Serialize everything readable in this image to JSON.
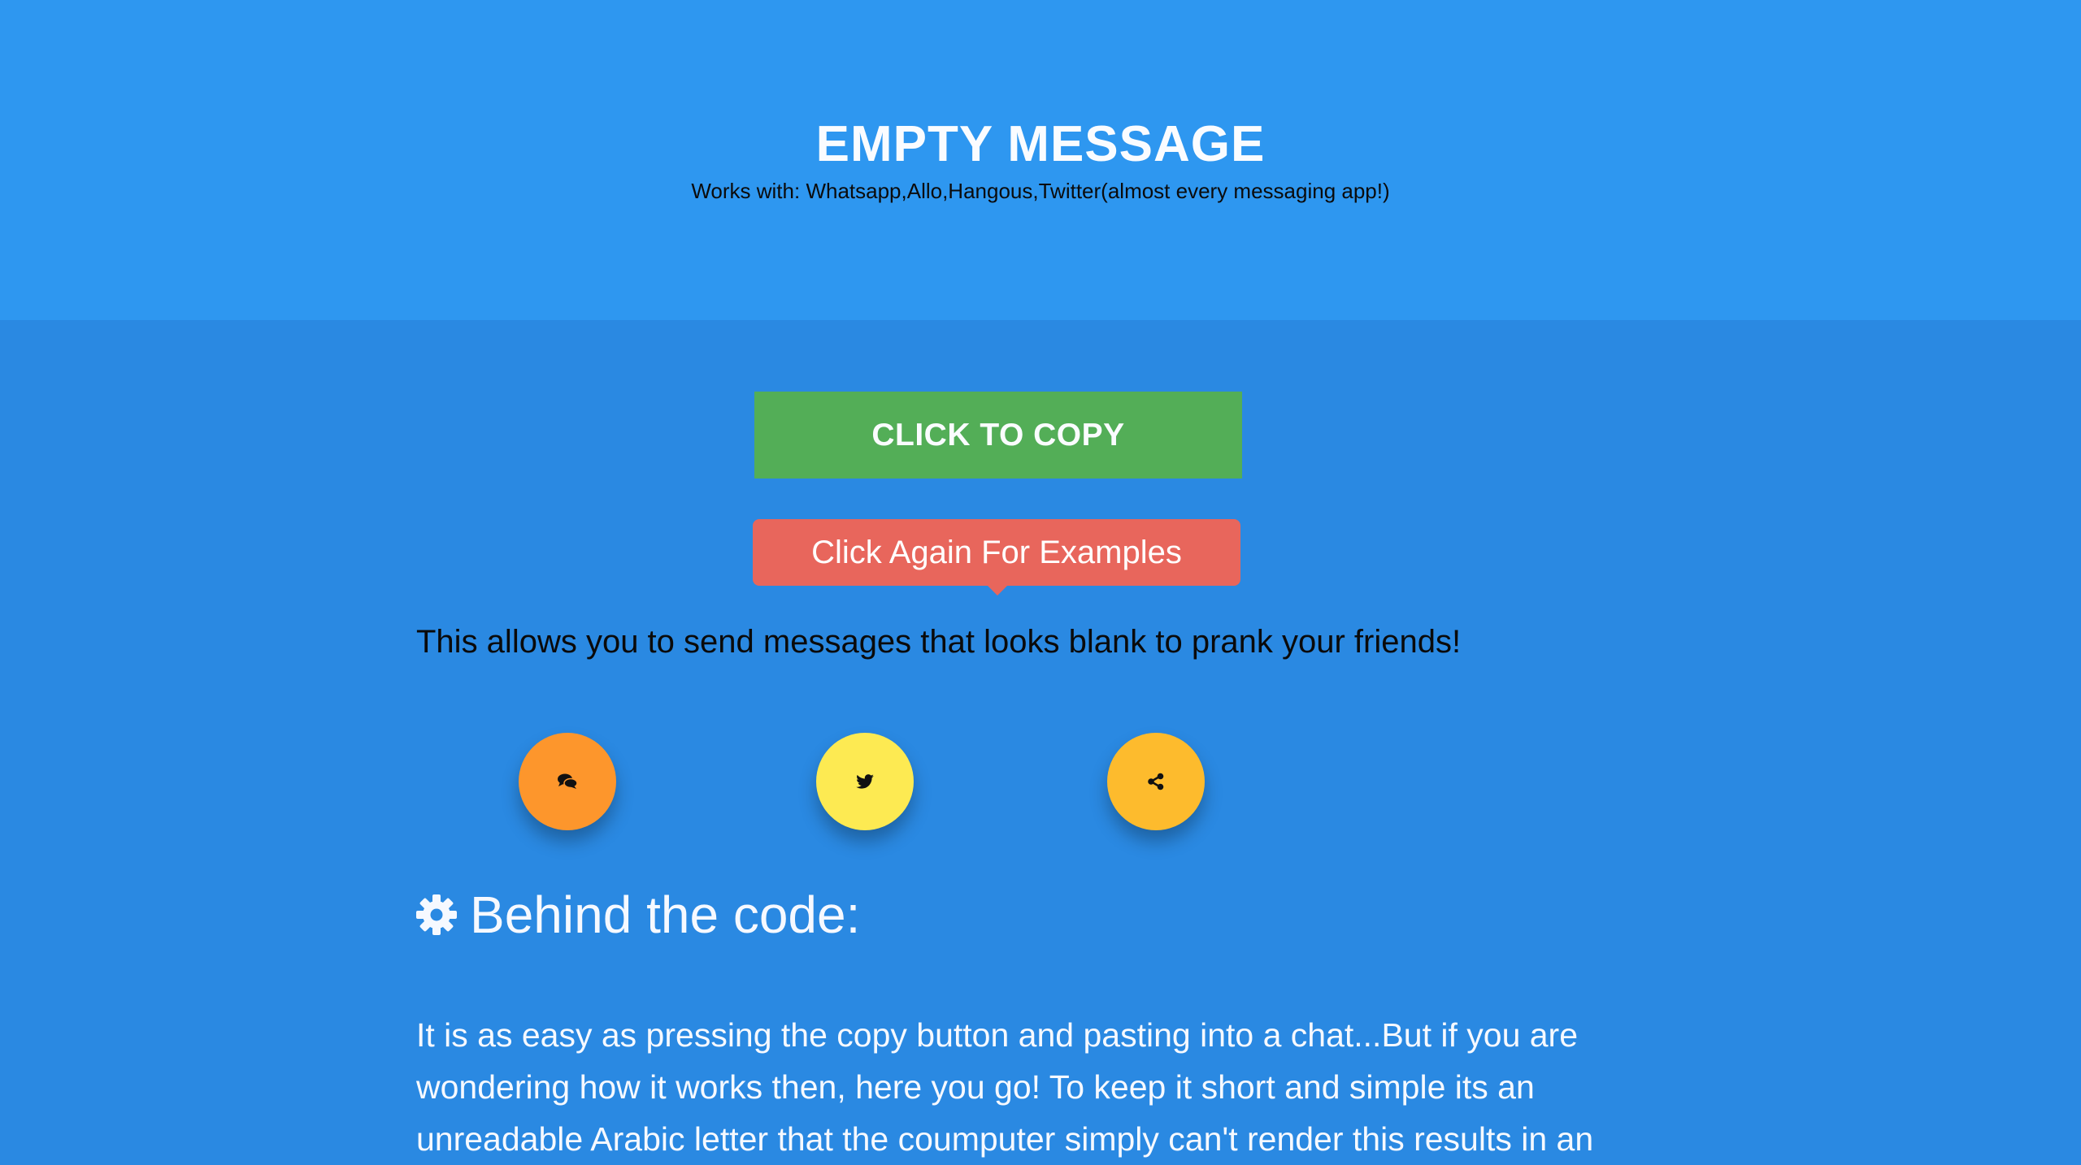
{
  "header": {
    "title": "EMPTY MESSAGE",
    "subtitle": "Works with: Whatsapp,Allo,Hangous,Twitter(almost every messaging app!)"
  },
  "main": {
    "copy_button_label": "CLICK TO COPY",
    "tooltip_text": "Click Again For Examples",
    "description": "This allows you to send messages that looks blank to prank your friends!",
    "share_buttons": [
      {
        "icon": "chat-icon",
        "color": "#fd962c"
      },
      {
        "icon": "twitter-icon",
        "color": "#fdea52"
      },
      {
        "icon": "share-icon",
        "color": "#fdbb2d"
      }
    ],
    "section_title": "Behind the code:",
    "section_icon": "gear-icon",
    "body_text": "It is as easy as pressing the copy button and pasting into a chat...But if you are wondering how it works then, here you go! To keep it short and simple its an unreadable Arabic letter that the coumputer simply can't render this results in an"
  },
  "colors": {
    "header_bg": "#2e97f0",
    "main_bg": "#2a89e2",
    "copy_button": "#53ae57",
    "tooltip": "#e8665c"
  }
}
